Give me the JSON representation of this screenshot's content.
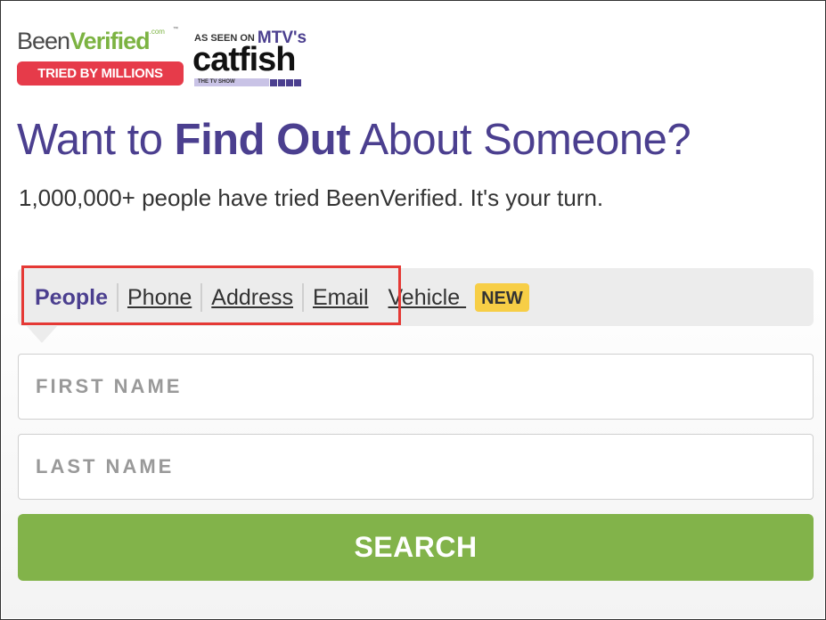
{
  "brand": {
    "name_part1": "Been",
    "name_part2": "Verified",
    "dotcom": ".com",
    "tm": "™",
    "tagline": "TRIED BY MILLIONS",
    "colors": {
      "purple": "#4b3f8f",
      "green": "#7cb342",
      "red": "#e63b4a"
    }
  },
  "promo": {
    "as_seen_on": "AS SEEN ON",
    "network": "MTV's",
    "show": "catfish",
    "show_sub": "THE TV SHOW"
  },
  "hero": {
    "headline_pre": "Want to ",
    "headline_bold": "Find Out",
    "headline_post": " About Someone?",
    "subhead": "1,000,000+ people have tried BeenVerified. It's your turn."
  },
  "tabs": [
    {
      "label": "People",
      "active": true
    },
    {
      "label": "Phone",
      "active": false
    },
    {
      "label": "Address",
      "active": false
    },
    {
      "label": "Email",
      "active": false
    },
    {
      "label": "Vehicle ",
      "active": false
    }
  ],
  "new_badge": "NEW",
  "form": {
    "first_name_placeholder": "FIRST NAME",
    "last_name_placeholder": "LAST NAME",
    "search_label": "SEARCH",
    "button_color": "#82b34a"
  }
}
